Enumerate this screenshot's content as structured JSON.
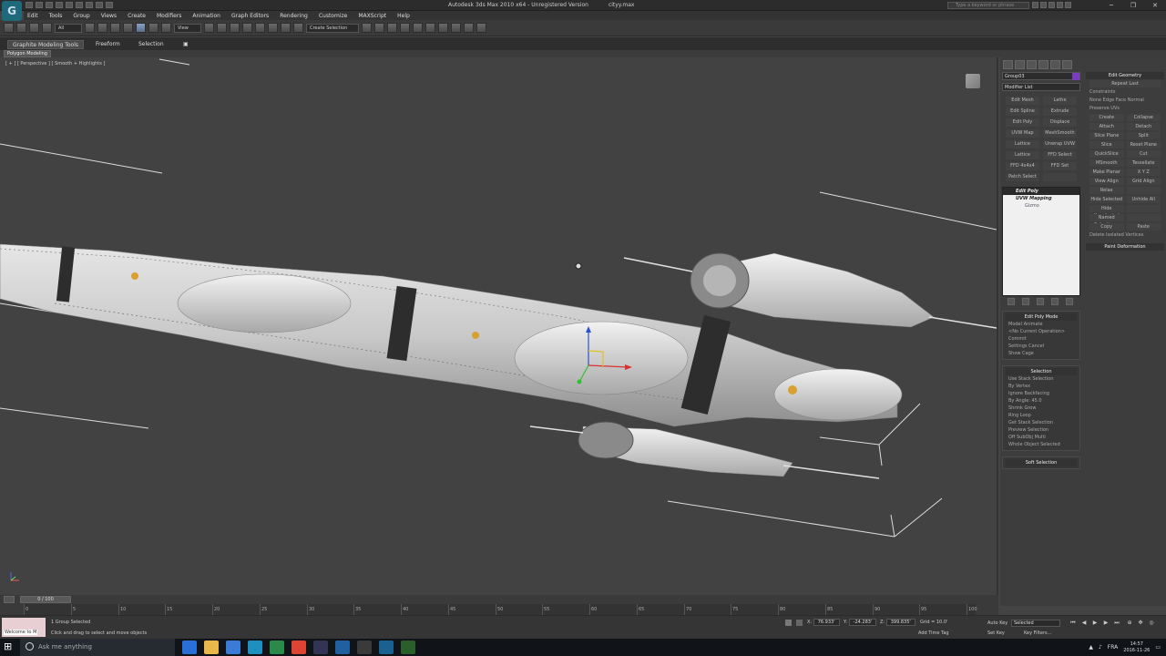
{
  "app": {
    "logo": "3ds-max-logo",
    "title": "Autodesk 3ds Max  2010 x64  -  Unregistered Version",
    "file": "cityy.max",
    "help_placeholder": "Type a keyword or phrase"
  },
  "menu": [
    "Edit",
    "Tools",
    "Group",
    "Views",
    "Create",
    "Modifiers",
    "Animation",
    "Graph Editors",
    "Rendering",
    "Customize",
    "MAXScript",
    "Help"
  ],
  "toolbar": {
    "selection_filter": "All",
    "reference_coord": "View",
    "named_selection": "Create Selection"
  },
  "ribbon": {
    "tabs": [
      "Graphite Modeling Tools",
      "Freeform",
      "Selection"
    ],
    "sub_label": "Polygon Modeling"
  },
  "viewport": {
    "label": "[ + ] [ Perspective ] [ Smooth + Highlights ]"
  },
  "command_panel": {
    "object_name": "Group03",
    "object_color": "#7a3cc0",
    "modifier_list": "Modifier List",
    "modifier_buttons": [
      "Edit Mesh",
      "Lathe",
      "Edit Spline",
      "Extrude",
      "Edit Poly",
      "Displace",
      "UVW Map",
      "MeshSmooth",
      "Lattice",
      "Unwrap UVW",
      "Lattice",
      "FFD Select",
      "FFD 4x4x4",
      "FFD Set",
      "Patch Select",
      ""
    ],
    "stack": [
      {
        "label": "Edit Poly",
        "selected": true
      },
      {
        "label": "UVW Mapping",
        "selected": false
      },
      {
        "label": "Gizmo",
        "sub": true
      }
    ],
    "edit_poly_mode": {
      "header": "Edit Poly Mode",
      "lines": [
        "Model      Animate",
        "<No Current Operation>",
        "Commit",
        "Settings    Cancel",
        "Show Cage"
      ]
    },
    "selection": {
      "header": "Selection",
      "lines": [
        "Use Stack Selection",
        "By Vertex",
        "Ignore Backfacing",
        "By Angle:  45.0",
        "Shrink      Grow",
        "Ring        Loop",
        "Get Stack Selection",
        "Preview Selection",
        "Off   SubObj   Multi",
        "Whole Object Selected"
      ]
    },
    "soft_selection": "Soft Selection",
    "edit_geometry": {
      "header": "Edit Geometry",
      "repeat": "Repeat Last",
      "constraints": "Constraints",
      "constraint_opts": "None   Edge   Face   Normal",
      "preserve_uvs": "Preserve UVs",
      "rows": [
        [
          "Create",
          "Collapse"
        ],
        [
          "Attach",
          "Detach"
        ],
        [
          "Slice Plane",
          "Split"
        ],
        [
          "Slice",
          "Reset Plane"
        ],
        [
          "QuickSlice",
          "Cut"
        ],
        [
          "MSmooth",
          "Tessellate"
        ],
        [
          "Make Planar",
          "X Y Z"
        ],
        [
          "View Align",
          "Grid Align"
        ],
        [
          "Relax",
          ""
        ],
        [
          "Hide Selected",
          "Unhide All"
        ],
        [
          "Hide Unselected",
          ""
        ],
        [
          "Named Selections:",
          ""
        ],
        [
          "Copy",
          "Paste"
        ]
      ],
      "delete_isolated": "Delete Isolated Vertices",
      "paint_deformation": "Paint Deformation"
    }
  },
  "timeline": {
    "slider": "0 / 100",
    "ticks": [
      "0",
      "5",
      "10",
      "15",
      "20",
      "25",
      "30",
      "35",
      "40",
      "45",
      "50",
      "55",
      "60",
      "65",
      "70",
      "75",
      "80",
      "85",
      "90",
      "95",
      "100"
    ]
  },
  "status": {
    "welcome": "Welcome to M",
    "line1": "1 Group Selected",
    "line2": "Click and drag to select and move objects",
    "x": "76.933'",
    "y": "-24.283'",
    "z": "399.835'",
    "grid": "Grid = 10.0'",
    "add_time_tag": "Add Time Tag",
    "auto_key": "Auto Key",
    "set_key": "Set Key",
    "selected": "Selected",
    "key_filters": "Key Filters..."
  },
  "taskbar": {
    "search": "Ask me anything",
    "lang": "FRA",
    "time": "14:57",
    "date": "2016-11-26",
    "apps": [
      "#2a6fd6",
      "#e8b84a",
      "#3a7bd5",
      "#1e90c0",
      "#2b8a4a",
      "#dd4433",
      "#333355",
      "#2060a0",
      "#3a3a3a",
      "#1a6090",
      "#2a5e2a"
    ]
  }
}
